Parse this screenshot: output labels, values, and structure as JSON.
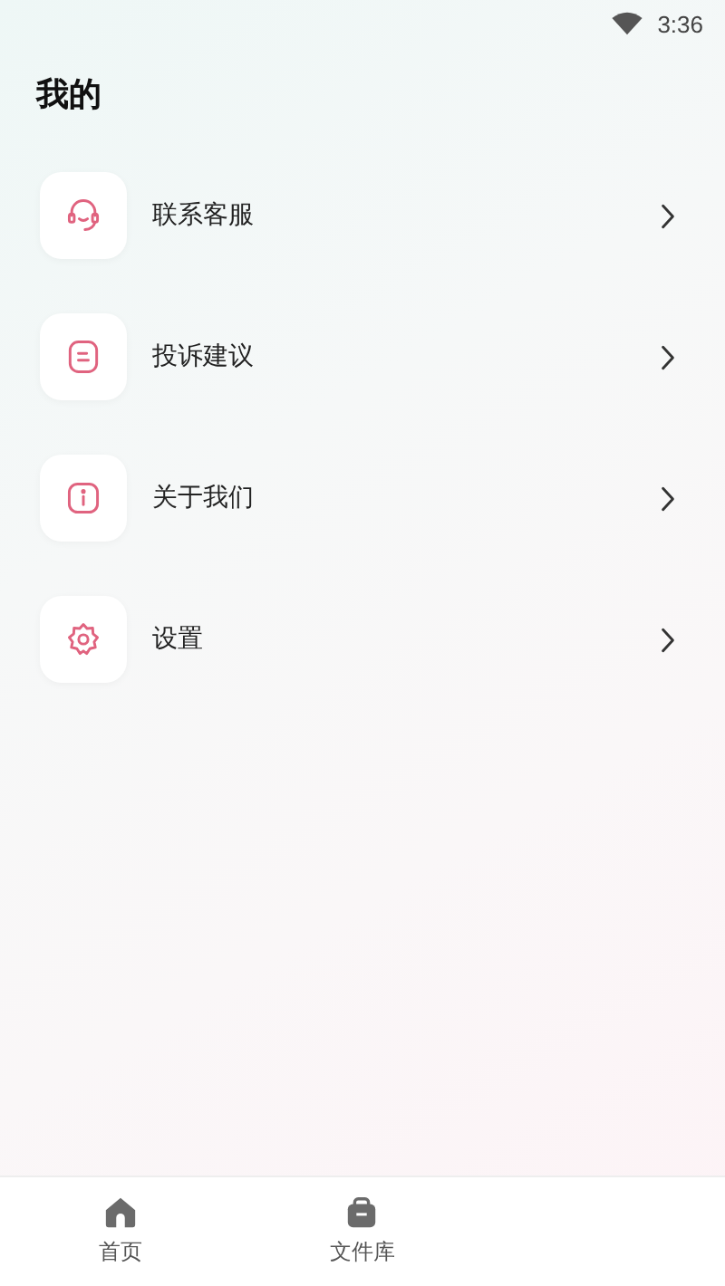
{
  "status_bar": {
    "time": "3:36"
  },
  "header": {
    "title": "我的"
  },
  "menu": [
    {
      "kind": "support",
      "label": "联系客服"
    },
    {
      "kind": "feedback",
      "label": "投诉建议"
    },
    {
      "kind": "about",
      "label": "关于我们"
    },
    {
      "kind": "settings",
      "label": "设置"
    }
  ],
  "bottom_nav": [
    {
      "kind": "home",
      "label": "首页",
      "selected": false
    },
    {
      "kind": "library",
      "label": "文件库",
      "selected": false
    }
  ]
}
